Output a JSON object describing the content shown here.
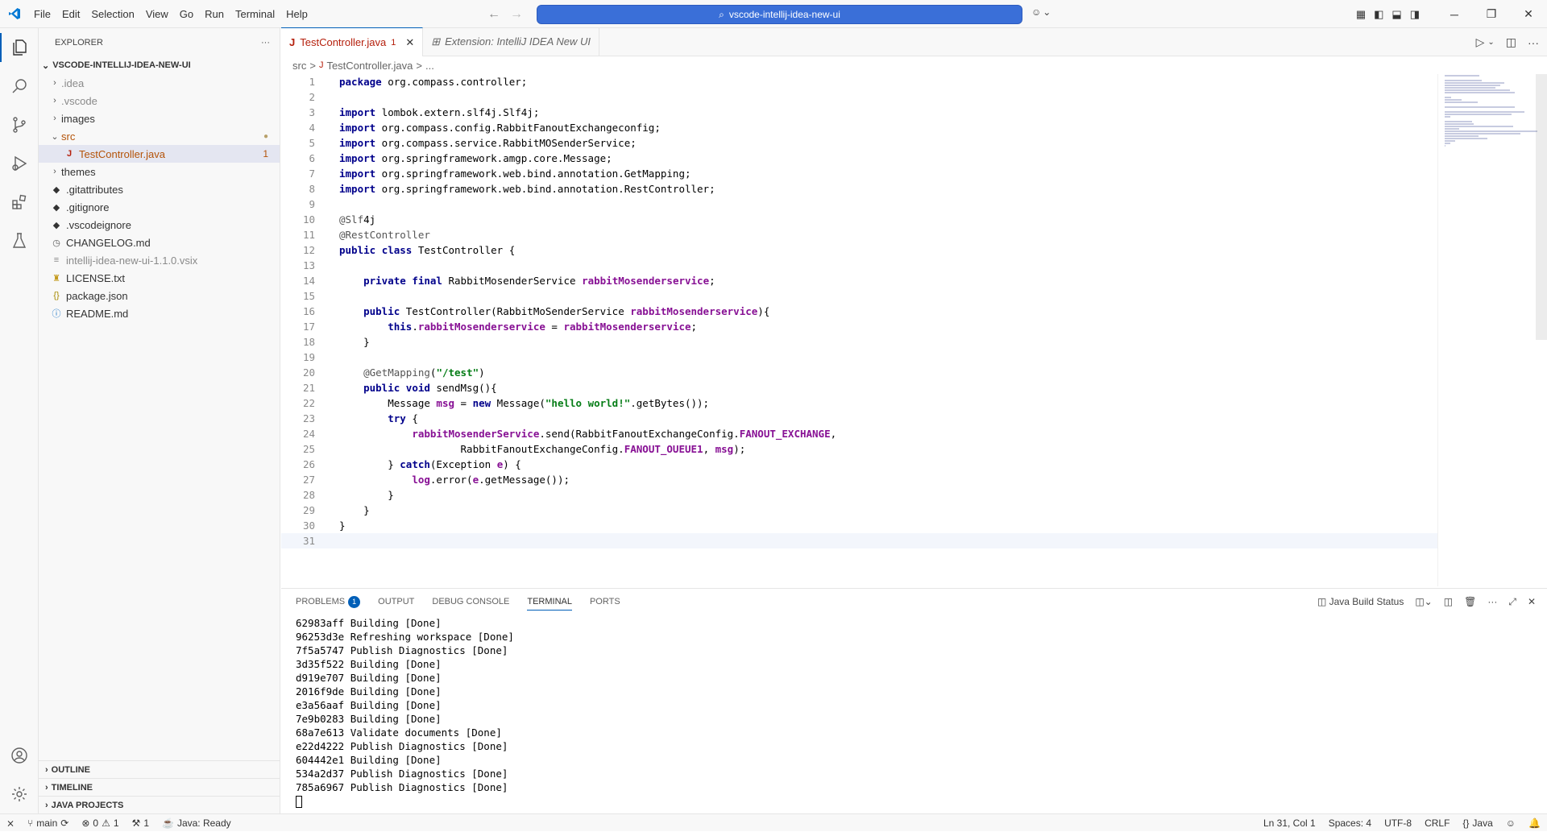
{
  "menu": [
    "File",
    "Edit",
    "Selection",
    "View",
    "Go",
    "Run",
    "Terminal",
    "Help"
  ],
  "command_center": "vscode-intellij-idea-new-ui",
  "sidebar": {
    "title": "EXPLORER",
    "root": "VSCODE-INTELLIJ-IDEA-NEW-UI",
    "items": [
      {
        "label": ".idea",
        "kind": "folder",
        "dim": true
      },
      {
        "label": ".vscode",
        "kind": "folder",
        "dim": true
      },
      {
        "label": "images",
        "kind": "folder"
      },
      {
        "label": "src",
        "kind": "folder-open",
        "modified": true
      },
      {
        "label": "TestController.java",
        "kind": "java",
        "badge": "1"
      },
      {
        "label": "themes",
        "kind": "folder"
      },
      {
        "label": ".gitattributes",
        "kind": "git"
      },
      {
        "label": ".gitignore",
        "kind": "git"
      },
      {
        "label": ".vscodeignore",
        "kind": "git"
      },
      {
        "label": "CHANGELOG.md",
        "kind": "md"
      },
      {
        "label": "intellij-idea-new-ui-1.1.0.vsix",
        "kind": "file",
        "dim": true
      },
      {
        "label": "LICENSE.txt",
        "kind": "license"
      },
      {
        "label": "package.json",
        "kind": "json"
      },
      {
        "label": "README.md",
        "kind": "info"
      }
    ],
    "bottom_sections": [
      "OUTLINE",
      "TIMELINE",
      "JAVA PROJECTS"
    ]
  },
  "tabs": [
    {
      "label": "TestController.java",
      "badge": "1",
      "active": true
    },
    {
      "label": "Extension: IntelliJ IDEA New UI",
      "active": false
    }
  ],
  "breadcrumb": [
    "src",
    ">",
    "TestController.java",
    ">",
    "..."
  ],
  "code_lines": [
    "package org.compass.controller;",
    "",
    "import lombok.extern.slf4j.Slf4j;",
    "import org.compass.config.RabbitFanoutExchangeconfig;",
    "import org.compass.service.RabbitMOSenderService;",
    "import org.springframework.amgp.core.Message;",
    "import org.springframework.web.bind.annotation.GetMapping;",
    "import org.springframework.web.bind.annotation.RestController;",
    "",
    "@Slf4j",
    "@RestController",
    "public class TestController {",
    "",
    "    private final RabbitMosenderService rabbitMosenderservice;",
    "",
    "    public TestController(RabbitMoSenderService rabbitMosenderservice){",
    "        this.rabbitMosenderservice = rabbitMosenderservice;",
    "    }",
    "",
    "    @GetMapping(\"/test\")",
    "    public void sendMsg(){",
    "        Message msg = new Message(\"hello world!\".getBytes());",
    "        try {",
    "            rabbitMosenderService.send(RabbitFanoutExchangeConfig.FANOUT_EXCHANGE,",
    "                    RabbitFanoutExchangeConfig.FANOUT_OUEUE1, msg);",
    "        } catch(Exception e) {",
    "            log.error(e.getMessage());",
    "        }",
    "    }",
    "}",
    ""
  ],
  "panel": {
    "tabs": [
      {
        "label": "PROBLEMS",
        "badge": "1"
      },
      {
        "label": "OUTPUT"
      },
      {
        "label": "DEBUG CONSOLE"
      },
      {
        "label": "TERMINAL",
        "active": true
      },
      {
        "label": "PORTS"
      }
    ],
    "java_build_status": "Java Build Status",
    "terminal_lines": [
      "62983aff Building [Done]",
      "96253d3e Refreshing workspace [Done]",
      "7f5a5747 Publish Diagnostics [Done]",
      "3d35f522 Building [Done]",
      "d919e707 Building [Done]",
      "2016f9de Building [Done]",
      "e3a56aaf Building [Done]",
      "7e9b0283 Building [Done]",
      "68a7e613 Validate documents [Done]",
      "e22d4222 Publish Diagnostics [Done]",
      "604442e1 Building [Done]",
      "534a2d37 Publish Diagnostics [Done]",
      "785a6967 Publish Diagnostics [Done]"
    ]
  },
  "status": {
    "branch": "main",
    "errors": "0",
    "warnings": "1",
    "ports": "1",
    "java": "Java: Ready",
    "position": "Ln 31, Col 1",
    "spaces": "Spaces: 4",
    "encoding": "UTF-8",
    "eol": "CRLF",
    "language": "Java"
  },
  "colors": {
    "accent": "#005fb8",
    "command_center": "#3a6fd8"
  }
}
